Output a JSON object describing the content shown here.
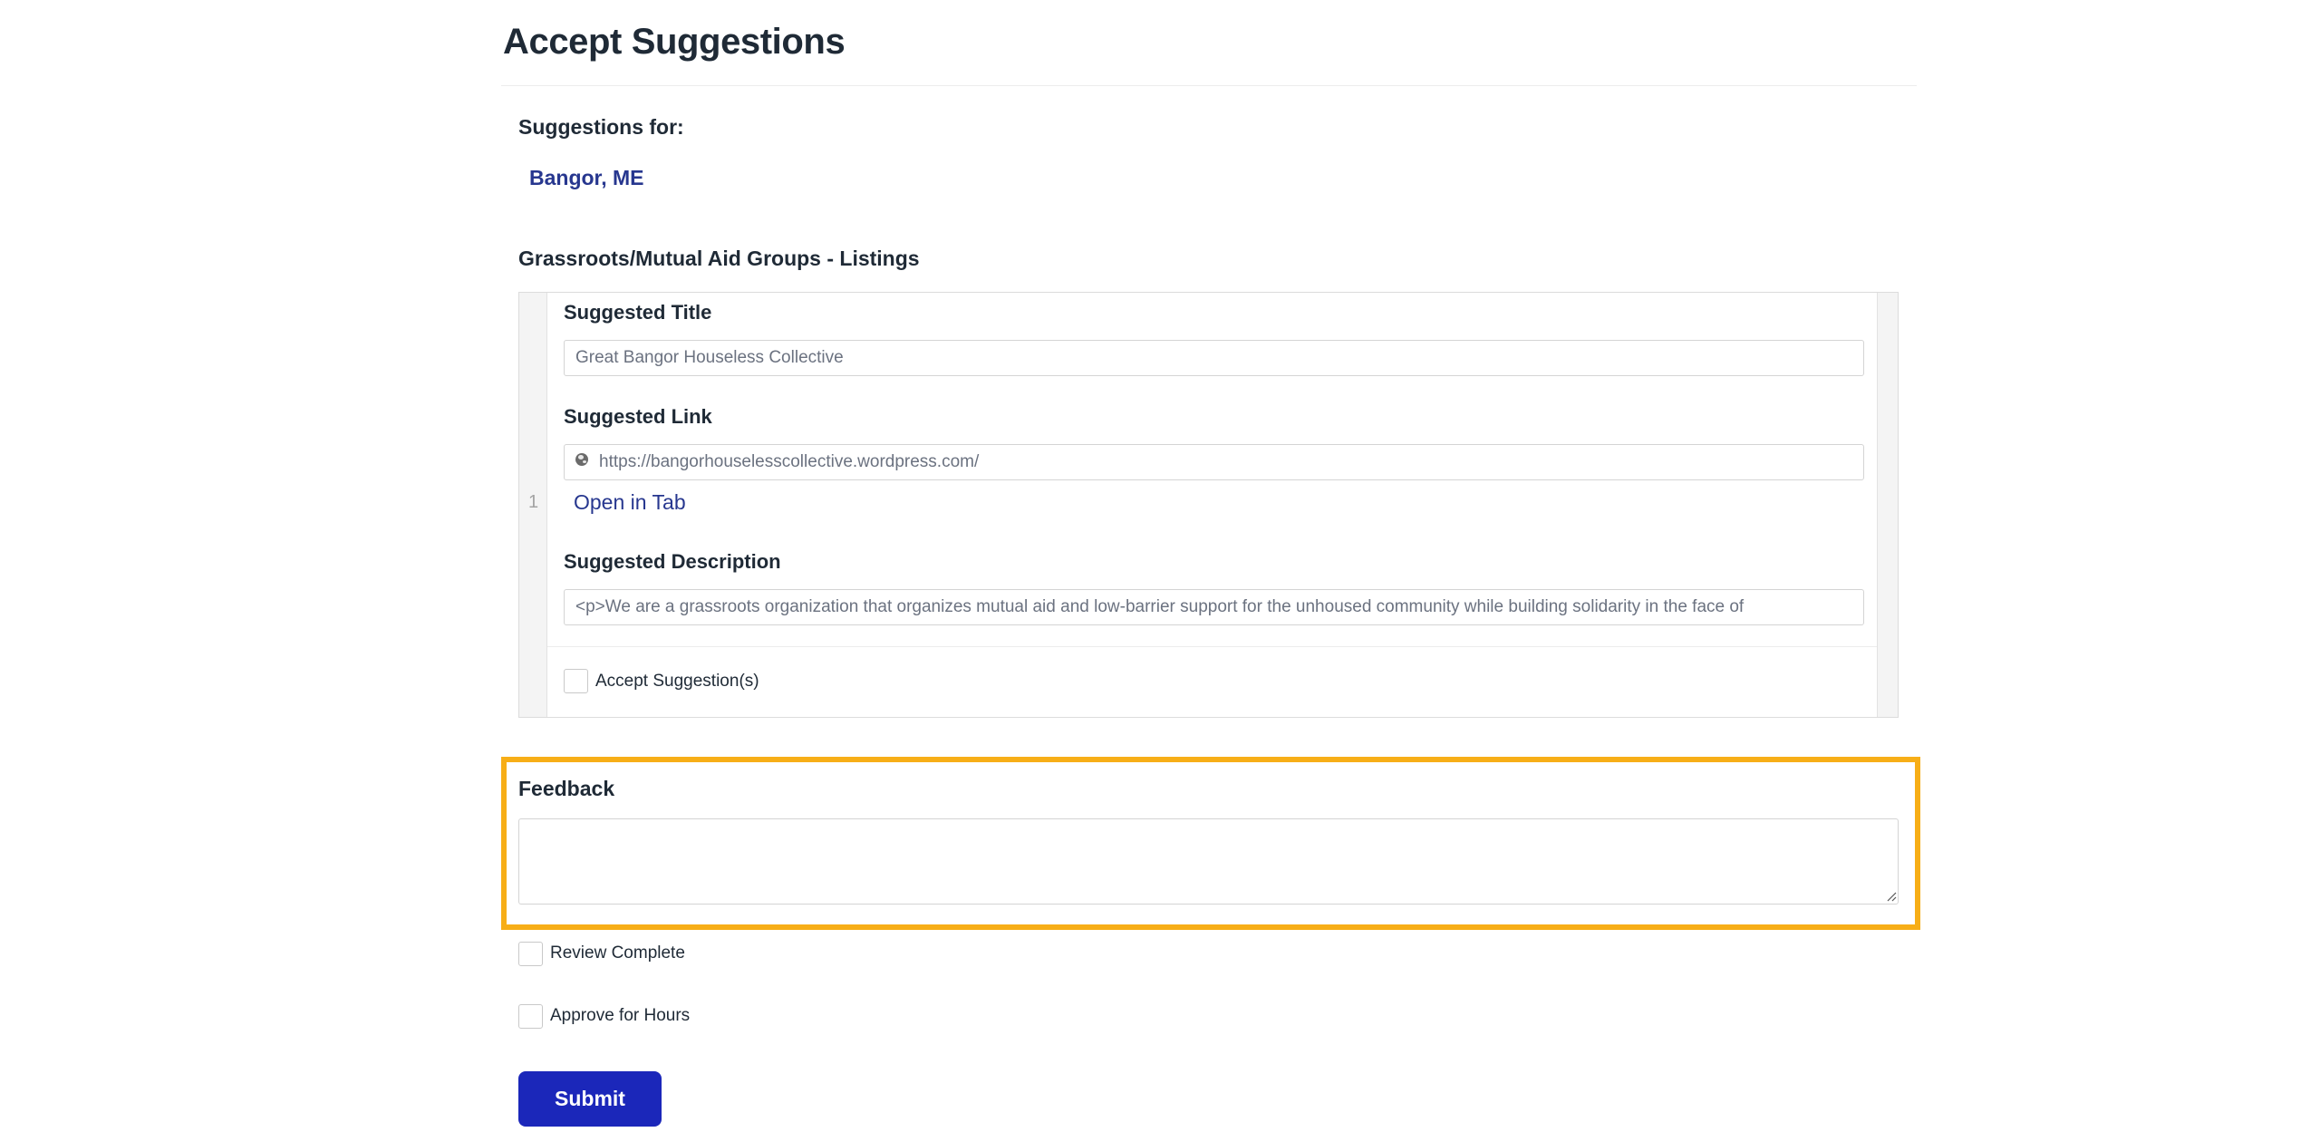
{
  "page": {
    "title": "Accept Suggestions"
  },
  "suggestions_for": {
    "label": "Suggestions for:",
    "city": "Bangor, ME"
  },
  "section": {
    "title": "Grassroots/Mutual Aid Groups - Listings"
  },
  "listing": {
    "row_number": "1",
    "title_label": "Suggested Title",
    "title_value": "Great Bangor Houseless Collective",
    "link_label": "Suggested Link",
    "link_value": "https://bangorhouselesscollective.wordpress.com/",
    "open_link": "Open in Tab",
    "description_label": "Suggested Description",
    "description_value": "<p>We are a grassroots organization that organizes mutual aid and low-barrier support for the unhoused community while building solidarity in the face of",
    "accept_label": "Accept Suggestion(s)"
  },
  "feedback": {
    "label": "Feedback",
    "value": ""
  },
  "review": {
    "review_complete_label": "Review Complete",
    "approve_hours_label": "Approve for Hours"
  },
  "actions": {
    "submit_label": "Submit"
  },
  "colors": {
    "accent": "#1b27ba",
    "link": "#27378f",
    "highlight": "#f7ae17"
  }
}
